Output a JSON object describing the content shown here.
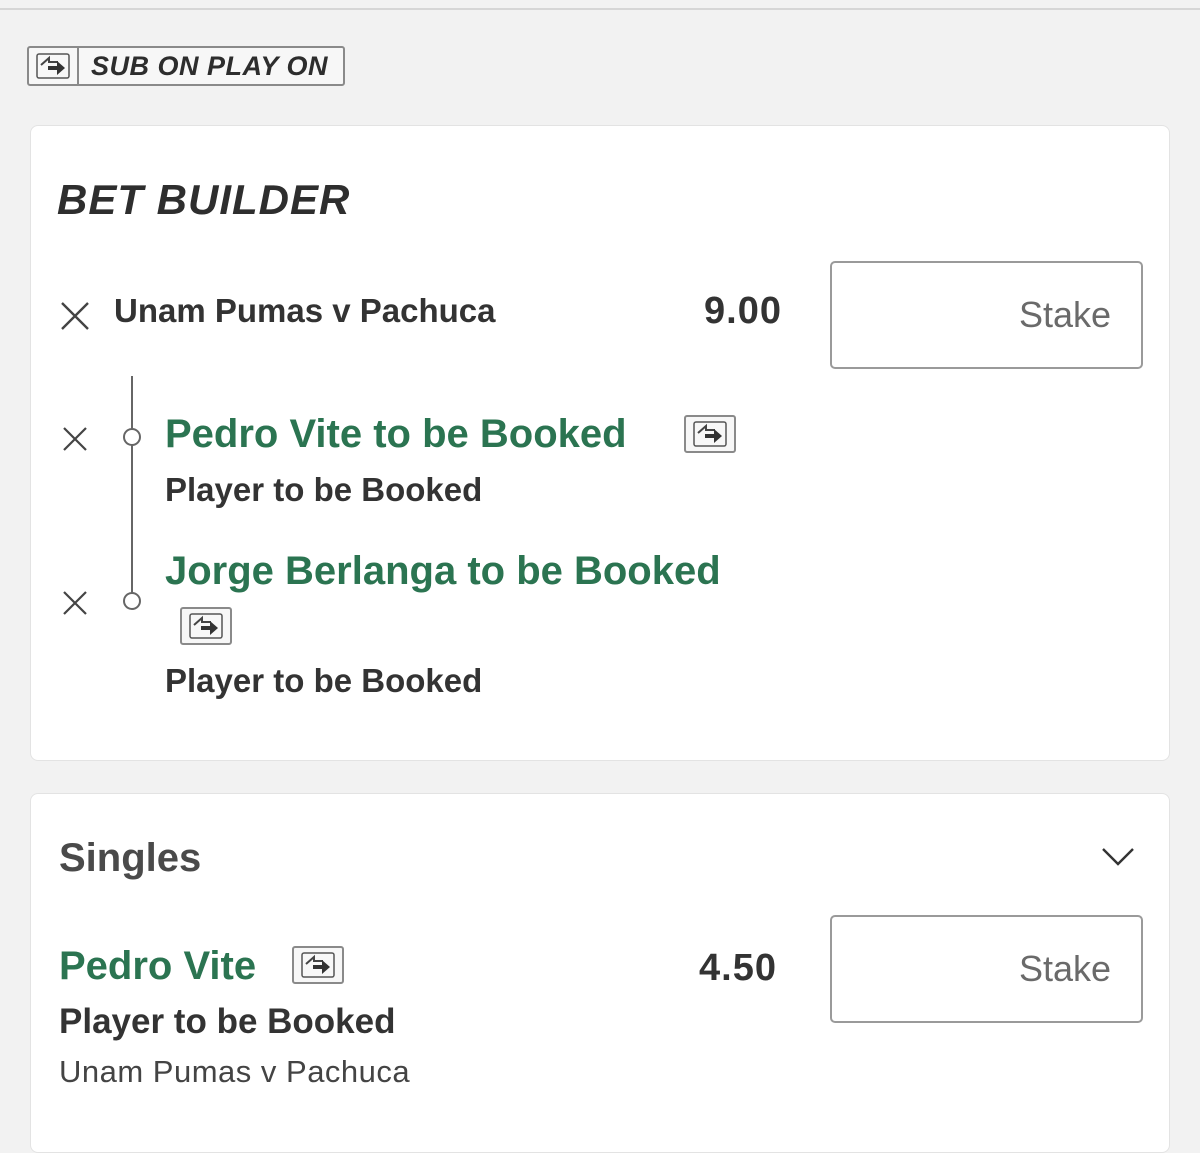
{
  "sub_on_play_on": {
    "label": "SUB ON PLAY ON",
    "icon": "sub-swap-icon"
  },
  "bet_builder": {
    "title": "BET BUILDER",
    "event": "Unam Pumas v Pachuca",
    "odds": "9.00",
    "stake_placeholder": "Stake",
    "legs": [
      {
        "selection": "Pedro Vite to be Booked",
        "market": "Player to be Booked",
        "icon": "sub-swap-icon"
      },
      {
        "selection": "Jorge Berlanga to be Booked",
        "market": "Player to be Booked",
        "icon": "sub-swap-icon"
      }
    ]
  },
  "singles": {
    "title": "Singles",
    "chevron_icon": "chevron-down-icon",
    "items": [
      {
        "selection": "Pedro Vite",
        "market": "Player to be Booked",
        "event": "Unam Pumas v Pachuca",
        "odds": "4.50",
        "stake_placeholder": "Stake",
        "icon": "sub-swap-icon"
      }
    ]
  },
  "colors": {
    "selection_green": "#2b7451",
    "background": "#f2f2f2",
    "card": "#ffffff",
    "border": "#9a9a9a"
  }
}
